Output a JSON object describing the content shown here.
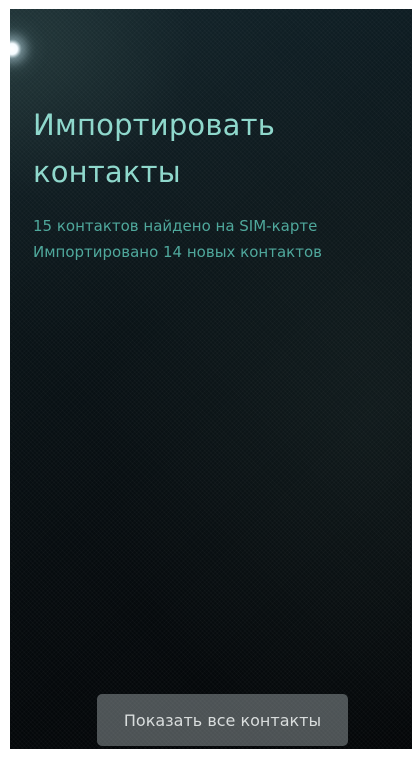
{
  "page": {
    "title": "Импортировать контакты",
    "status": [
      "15 контактов найдено на SIM-карте",
      "Импортировано 14 новых контактов"
    ],
    "show_all_button": "Показать все контакты"
  },
  "colors": {
    "title": "#8fd8cc",
    "status_text": "#4fa89c",
    "background": "#060b0e",
    "button_text": "#d9dddd"
  },
  "icons": {
    "pulley_indicator": "pulley-menu-glow-icon"
  }
}
